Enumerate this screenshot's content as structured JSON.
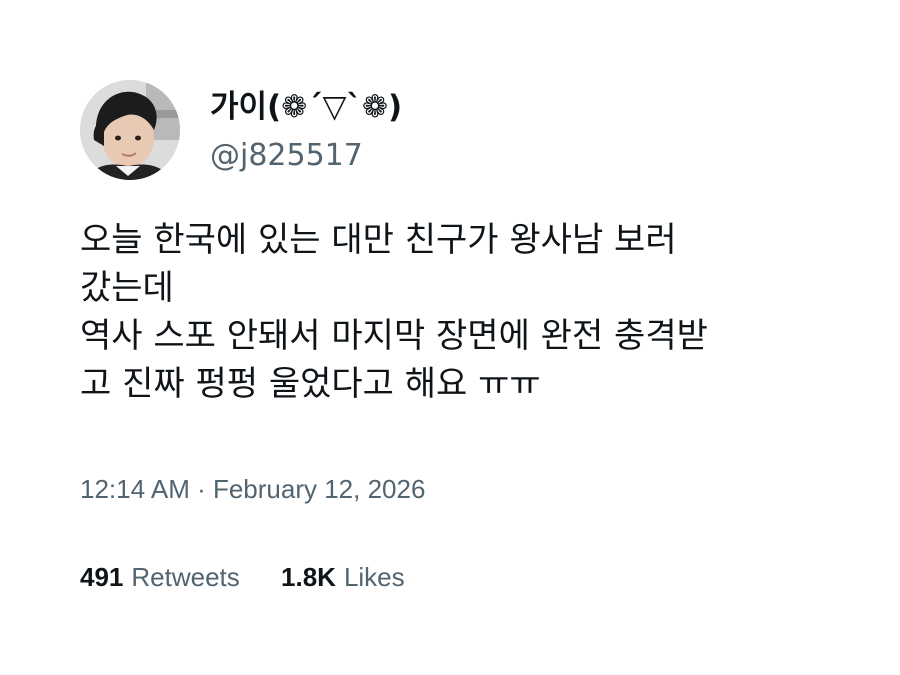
{
  "author": {
    "display_name": "가이(❁´▽`❁)",
    "handle": "@j825517"
  },
  "tweet": {
    "lines": [
      "오늘 한국에 있는 대만 친구가 왕사남 보러",
      "갔는데",
      "역사 스포 안돼서 마지막 장면에 완전 충격받",
      "고 진짜 펑펑 울었다고 해요 ㅠㅠ"
    ],
    "timestamp": "12:14 AM · February 12, 2026"
  },
  "stats": {
    "retweets_count": "491",
    "retweets_label": "Retweets",
    "likes_count": "1.8K",
    "likes_label": "Likes"
  },
  "colors": {
    "text_primary": "#0f1419",
    "text_secondary": "#536471",
    "background": "#ffffff"
  }
}
